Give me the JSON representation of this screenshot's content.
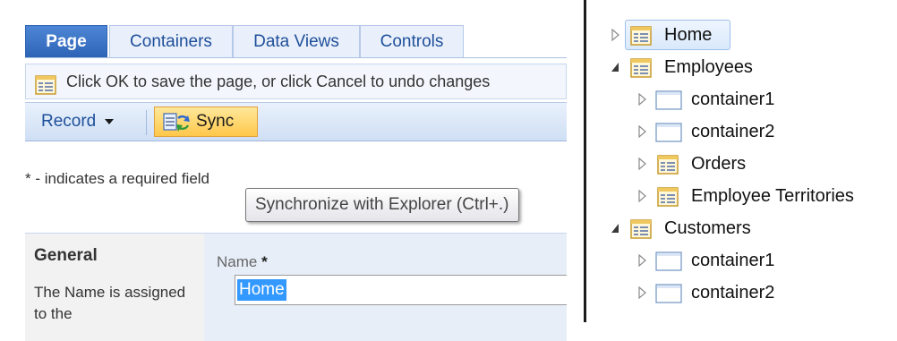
{
  "editor": {
    "tabs": [
      {
        "label": "Page",
        "active": true
      },
      {
        "label": "Containers",
        "active": false
      },
      {
        "label": "Data Views",
        "active": false
      },
      {
        "label": "Controls",
        "active": false
      }
    ],
    "info_text": "Click OK to save the page, or click Cancel to undo changes",
    "toolbar": {
      "record_label": "Record",
      "sync_label": "Sync"
    },
    "required_note": "* - indicates a required field",
    "tooltip": "Synchronize with Explorer (Ctrl+.)",
    "section": {
      "title": "General",
      "description": "The Name is assigned to the"
    },
    "name_field": {
      "label": "Name",
      "required_mark": "*",
      "value": "Home"
    }
  },
  "tree": {
    "nodes": [
      {
        "label": "Home",
        "icon": "page-icon",
        "state": "collapsed",
        "selected": true
      },
      {
        "label": "Employees",
        "icon": "page-icon",
        "state": "expanded"
      },
      {
        "label": "container1",
        "icon": "container-icon",
        "state": "collapsed"
      },
      {
        "label": "container2",
        "icon": "container-icon",
        "state": "collapsed"
      },
      {
        "label": "Orders",
        "icon": "page-icon",
        "state": "collapsed"
      },
      {
        "label": "Employee Territories",
        "icon": "page-icon",
        "state": "collapsed"
      },
      {
        "label": "Customers",
        "icon": "page-icon",
        "state": "expanded"
      },
      {
        "label": "container1",
        "icon": "container-icon",
        "state": "collapsed"
      },
      {
        "label": "container2",
        "icon": "container-icon",
        "state": "collapsed"
      }
    ]
  },
  "colors": {
    "active_tab": "#3e77c9",
    "sync_button": "#ffc84a",
    "selection": "#3399ff"
  }
}
